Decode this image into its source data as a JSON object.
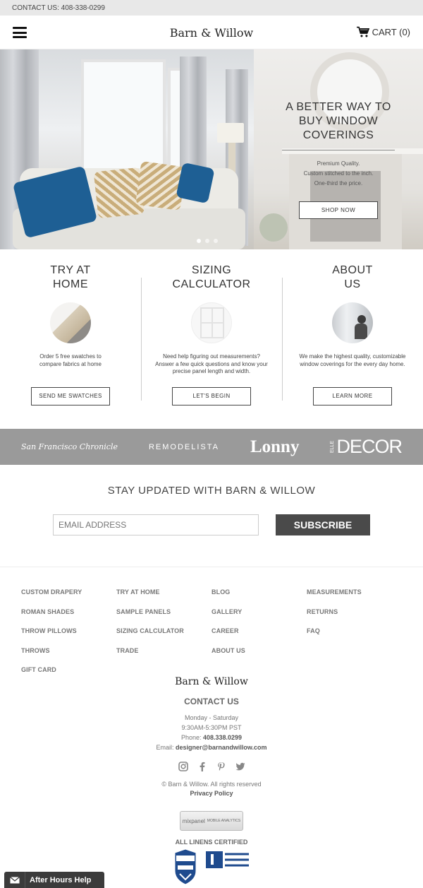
{
  "topbar": {
    "contact": "CONTACT US: 408-338-0299"
  },
  "header": {
    "brand": "Barn & Willow",
    "cart_label": "CART (0)"
  },
  "hero": {
    "title": "A BETTER WAY TO BUY WINDOW COVERINGS",
    "subtitle_lines": [
      "Premium Quality.",
      "Custom stitched to the inch.",
      "One-third the price."
    ],
    "cta": "SHOP NOW",
    "slide_count": 3,
    "active_slide": 1
  },
  "features": [
    {
      "title": "TRY AT HOME",
      "description": "Order 5 free swatches to compare fabrics at home",
      "button": "SEND ME SWATCHES",
      "icon": "swatch-image"
    },
    {
      "title": "SIZING CALCULATOR",
      "description": "Need help figuring out measurements? Answer a few quick questions and know your precise panel length and width.",
      "button": "LET'S BEGIN",
      "icon": "window-image"
    },
    {
      "title": "ABOUT US",
      "description": "We make the highest quality, customizable window coverings for the every day home.",
      "button": "LEARN MORE",
      "icon": "person-image"
    }
  ],
  "press": [
    "San Francisco Chronicle",
    "REMODELISTA",
    "Lonny",
    "ELLE",
    "DECOR"
  ],
  "newsletter": {
    "title": "STAY UPDATED WITH BARN & WILLOW",
    "placeholder": "EMAIL ADDRESS",
    "button": "SUBSCRIBE"
  },
  "footer": {
    "columns": [
      [
        "CUSTOM DRAPERY",
        "ROMAN SHADES",
        "THROW PILLOWS",
        "THROWS",
        "GIFT CARD"
      ],
      [
        "TRY AT HOME",
        "SAMPLE PANELS",
        "SIZING CALCULATOR",
        "TRADE"
      ],
      [
        "BLOG",
        "GALLERY",
        "CAREER",
        "ABOUT US"
      ],
      [
        "MEASUREMENTS",
        "RETURNS",
        "FAQ"
      ]
    ],
    "brand": "Barn & Willow",
    "contact_title": "CONTACT US",
    "hours_days": "Monday - Saturday",
    "hours_time": "9:30AM-5:30PM PST",
    "phone_label": "Phone:",
    "phone": "408.338.0299",
    "email_label": "Email:",
    "email": "designer@barnandwillow.com",
    "social": [
      "instagram-icon",
      "facebook-icon",
      "pinterest-icon",
      "twitter-icon"
    ],
    "copyright": "© Barn & Willow. All rights reserved",
    "privacy": "Privacy Policy",
    "mixpanel": "mixpanel",
    "mixpanel_sub": "MOBILE ANALYTICS",
    "certified": "ALL LINENS CERTIFIED",
    "badge_belgian": "BELGIAN LINEN",
    "badge_masters": "MASTERS OF LINEN"
  },
  "chat": {
    "label": "After Hours Help"
  }
}
